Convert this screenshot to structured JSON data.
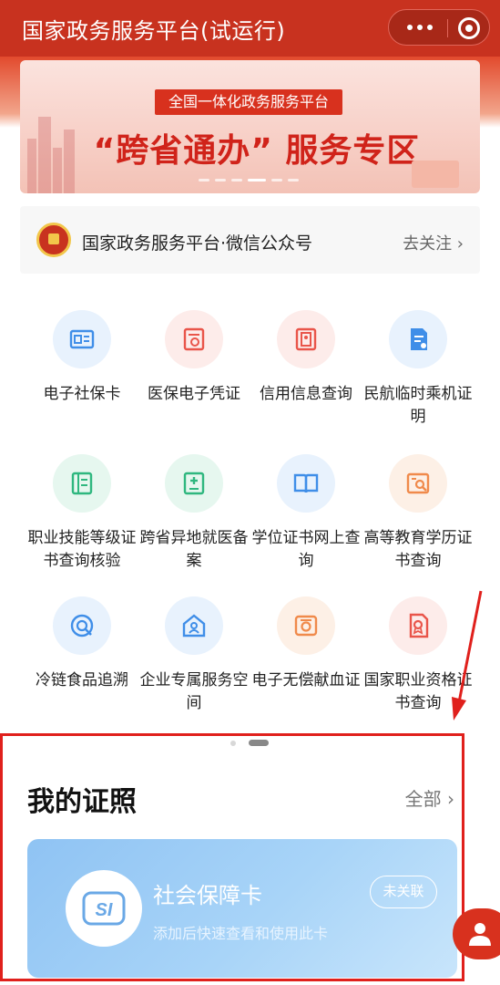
{
  "header": {
    "title": "国家政务服务平台(试运行)"
  },
  "banner": {
    "tag": "全国一体化政务服务平台",
    "headline": "“跨省通办” 服务专区"
  },
  "official_account": {
    "name": "国家政务服务平台·微信公众号",
    "follow_label": "去关注 ›"
  },
  "services": [
    {
      "label": "电子社保卡",
      "icon": "social-security-card-icon",
      "color": "#3f8ee8",
      "bg": "#e8f2fd"
    },
    {
      "label": "医保电子凭证",
      "icon": "medical-voucher-icon",
      "color": "#e9554a",
      "bg": "#fdecea"
    },
    {
      "label": "信用信息查询",
      "icon": "credit-info-icon",
      "color": "#e9554a",
      "bg": "#fdecea"
    },
    {
      "label": "民航临时乘机证明",
      "icon": "boarding-certificate-icon",
      "color": "#3f8ee8",
      "bg": "#e8f2fd"
    },
    {
      "label": "职业技能等级证书查询核验",
      "icon": "skill-certificate-icon",
      "color": "#2fb77f",
      "bg": "#e6f7ef"
    },
    {
      "label": "跨省异地就医备案",
      "icon": "medical-filing-icon",
      "color": "#2fb77f",
      "bg": "#e6f7ef"
    },
    {
      "label": "学位证书网上查询",
      "icon": "degree-book-icon",
      "color": "#3f8ee8",
      "bg": "#e8f2fd"
    },
    {
      "label": "高等教育学历证书查询",
      "icon": "education-certificate-icon",
      "color": "#f08a4b",
      "bg": "#fdf0e6"
    },
    {
      "label": "冷链食品追溯",
      "icon": "cold-chain-icon",
      "color": "#3f8ee8",
      "bg": "#e8f2fd"
    },
    {
      "label": "企业专属服务空间",
      "icon": "enterprise-space-icon",
      "color": "#3f8ee8",
      "bg": "#e8f2fd"
    },
    {
      "label": "电子无偿献血证",
      "icon": "blood-donation-icon",
      "color": "#f08a4b",
      "bg": "#fdf0e6"
    },
    {
      "label": "国家职业资格证书查询",
      "icon": "professional-qualification-icon",
      "color": "#e9554a",
      "bg": "#fdecea"
    }
  ],
  "my_certificates": {
    "heading": "我的证照",
    "all_label": "全部 ›",
    "card": {
      "name": "社会保障卡",
      "description": "添加后快速查看和使用此卡",
      "status": "未关联",
      "logo_text": "SI"
    }
  },
  "colors": {
    "brand_red": "#c8321f",
    "annotation_red": "#e0201c"
  }
}
